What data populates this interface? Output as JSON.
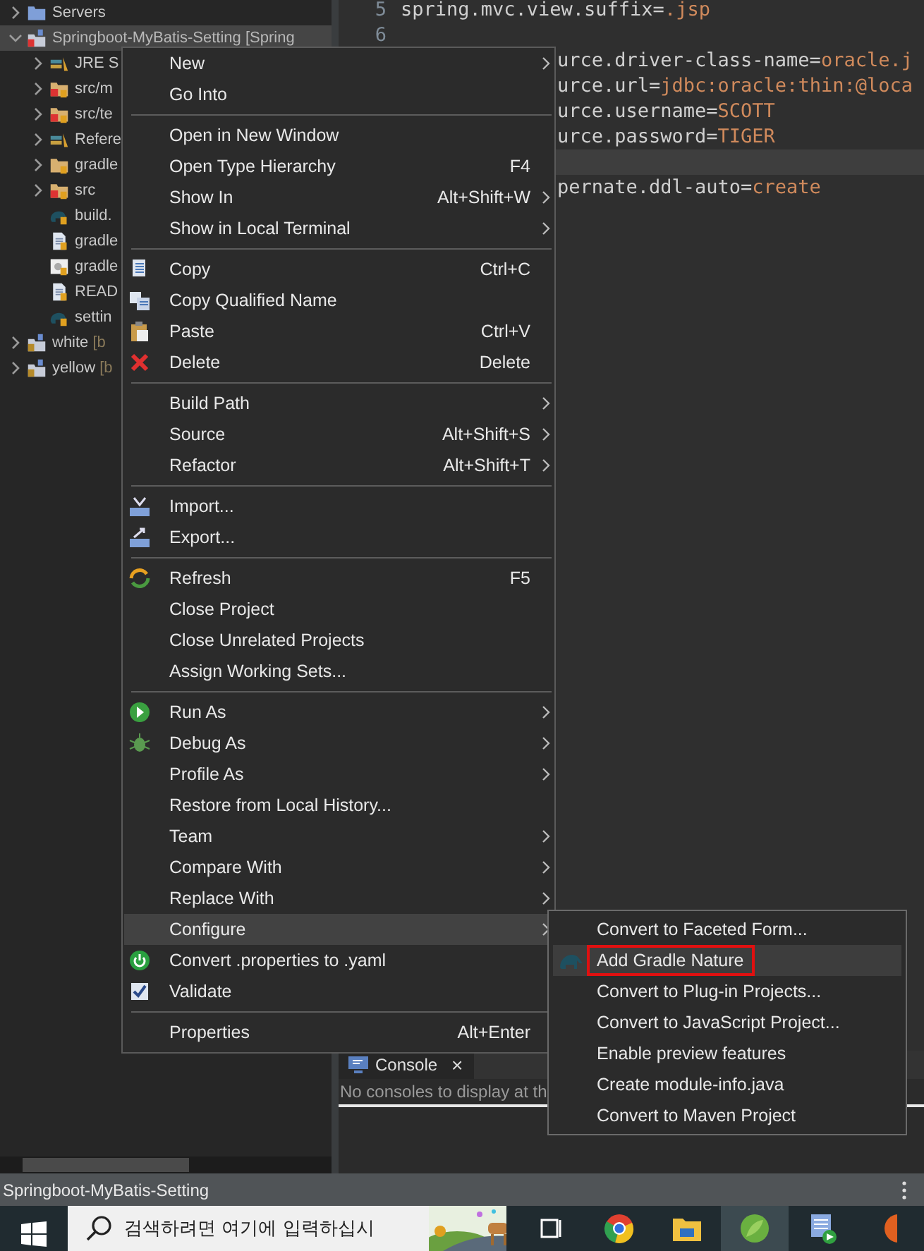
{
  "explorer": {
    "items": [
      {
        "kind": "folder",
        "label": "Servers",
        "expanded": false,
        "selected": false
      },
      {
        "kind": "project",
        "label": "Springboot-MyBatis-Setting [Spring",
        "expanded": true,
        "selected": true,
        "children": [
          {
            "kind": "folder",
            "label": "JRE S",
            "expanded": false,
            "selected": false
          },
          {
            "kind": "folder",
            "label": "src/m",
            "expanded": false,
            "selected": false
          },
          {
            "kind": "folder",
            "label": "src/te",
            "expanded": false,
            "selected": false
          },
          {
            "kind": "folder",
            "label": "Refere",
            "expanded": false,
            "selected": false
          },
          {
            "kind": "folder",
            "label": "gradle",
            "expanded": false,
            "selected": false
          },
          {
            "kind": "folder",
            "label": "src",
            "expanded": false,
            "selected": false
          },
          {
            "kind": "file",
            "label": "build.",
            "selected": false
          },
          {
            "kind": "file",
            "label": "gradle",
            "selected": false
          },
          {
            "kind": "file",
            "label": "gradle",
            "selected": false
          },
          {
            "kind": "file",
            "label": "READ",
            "selected": false
          },
          {
            "kind": "file",
            "label": "settin",
            "selected": false
          }
        ]
      },
      {
        "kind": "project",
        "label": "white",
        "decoration": "[b",
        "expanded": false,
        "selected": false
      },
      {
        "kind": "project",
        "label": "yellow",
        "decoration": "[b",
        "expanded": false,
        "selected": false
      }
    ]
  },
  "editor": {
    "lines": [
      {
        "number": "5",
        "key": "spring.mvc.view.suffix=",
        "value": ".jsp",
        "current": false
      },
      {
        "number": "6",
        "current": false
      },
      {
        "key": "urce.driver-class-name=",
        "value": "oracle.j",
        "current": false
      },
      {
        "key": "urce.url=",
        "value": "jdbc:oracle:thin:@loca",
        "current": false
      },
      {
        "key": "urce.username=",
        "value": "SCOTT",
        "current": false
      },
      {
        "key": "urce.password=",
        "value": "TIGER",
        "current": false
      },
      {
        "current": true
      },
      {
        "key": "pernate.ddl-auto=",
        "value": "create",
        "current": false
      }
    ]
  },
  "console": {
    "tab": {
      "label": "Console",
      "close": "×"
    },
    "message": "No consoles to display at th"
  },
  "context_menu": {
    "groups": [
      [
        {
          "label": "New",
          "has_submenu": true,
          "selected": false
        },
        {
          "label": "Go Into",
          "has_submenu": false,
          "selected": false
        }
      ],
      [
        {
          "label": "Open in New Window",
          "has_submenu": false,
          "selected": false
        },
        {
          "label": "Open Type Hierarchy",
          "shortcut": "F4",
          "has_submenu": false,
          "selected": false
        },
        {
          "label": "Show In",
          "shortcut": "Alt+Shift+W",
          "has_submenu": true,
          "selected": false
        },
        {
          "label": "Show in Local Terminal",
          "has_submenu": true,
          "selected": false
        }
      ],
      [
        {
          "label": "Copy",
          "shortcut": "Ctrl+C",
          "has_submenu": false,
          "selected": false
        },
        {
          "label": "Copy Qualified Name",
          "has_submenu": false,
          "selected": false
        },
        {
          "label": "Paste",
          "shortcut": "Ctrl+V",
          "has_submenu": false,
          "selected": false
        },
        {
          "label": "Delete",
          "shortcut": "Delete",
          "has_submenu": false,
          "selected": false
        }
      ],
      [
        {
          "label": "Build Path",
          "has_submenu": true,
          "selected": false
        },
        {
          "label": "Source",
          "shortcut": "Alt+Shift+S",
          "has_submenu": true,
          "selected": false
        },
        {
          "label": "Refactor",
          "shortcut": "Alt+Shift+T",
          "has_submenu": true,
          "selected": false
        }
      ],
      [
        {
          "label": "Import...",
          "has_submenu": false,
          "selected": false
        },
        {
          "label": "Export...",
          "has_submenu": false,
          "selected": false
        }
      ],
      [
        {
          "label": "Refresh",
          "shortcut": "F5",
          "has_submenu": false,
          "selected": false
        },
        {
          "label": "Close Project",
          "has_submenu": false,
          "selected": false
        },
        {
          "label": "Close Unrelated Projects",
          "has_submenu": false,
          "selected": false
        },
        {
          "label": "Assign Working Sets...",
          "has_submenu": false,
          "selected": false
        }
      ],
      [
        {
          "label": "Run As",
          "has_submenu": true,
          "selected": false
        },
        {
          "label": "Debug As",
          "has_submenu": true,
          "selected": false
        },
        {
          "label": "Profile As",
          "has_submenu": true,
          "selected": false
        },
        {
          "label": "Restore from Local History...",
          "has_submenu": false,
          "selected": false
        },
        {
          "label": "Team",
          "has_submenu": true,
          "selected": false
        },
        {
          "label": "Compare With",
          "has_submenu": true,
          "selected": false
        },
        {
          "label": "Replace With",
          "has_submenu": true,
          "selected": false
        },
        {
          "label": "Configure",
          "has_submenu": true,
          "selected": true
        },
        {
          "label": "Convert .properties to .yaml",
          "has_submenu": false,
          "selected": false
        },
        {
          "label": "Validate",
          "has_submenu": false,
          "selected": false
        }
      ],
      [
        {
          "label": "Properties",
          "shortcut": "Alt+Enter",
          "has_submenu": false,
          "selected": false
        }
      ]
    ]
  },
  "submenu": {
    "items": [
      {
        "label": "Convert to Faceted Form...",
        "selected": false,
        "marked": false
      },
      {
        "label": "Add Gradle Nature",
        "selected": true,
        "marked": true
      },
      {
        "label": "Convert to Plug-in Projects...",
        "selected": false,
        "marked": false
      },
      {
        "label": "Convert to JavaScript Project...",
        "selected": false,
        "marked": false
      },
      {
        "label": "Enable preview features",
        "selected": false,
        "marked": false
      },
      {
        "label": "Create module-info.java",
        "selected": false,
        "marked": false
      },
      {
        "label": "Convert to Maven Project",
        "selected": false,
        "marked": false
      }
    ]
  },
  "status_bar": {
    "text": "Springboot-MyBatis-Setting"
  },
  "taskbar": {
    "search": {
      "placeholder": "검색하려면 여기에 입력하십시"
    },
    "apps": [
      {
        "selected": false
      },
      {
        "selected": false
      },
      {
        "selected": false
      },
      {
        "selected": true
      },
      {
        "selected": false
      },
      {
        "selected": false
      }
    ]
  }
}
